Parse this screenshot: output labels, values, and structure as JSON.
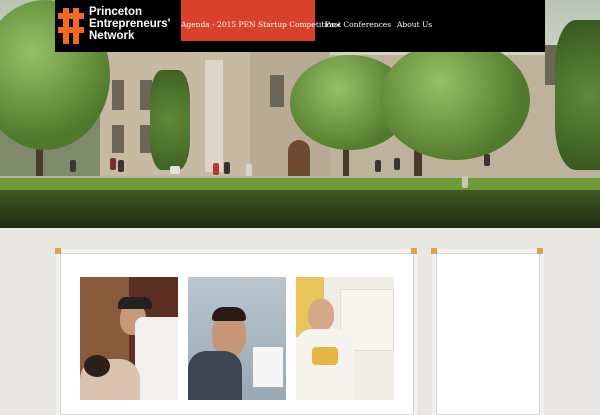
{
  "site": {
    "logo_line1": "Princeton",
    "logo_line2": "Entrepreneurs'",
    "logo_line3": "Network",
    "logo_icon": "pen-monogram-icon",
    "brand_color": "#f26a21"
  },
  "nav": {
    "items": [
      {
        "label": "Agenda - 2015 PEN Startup Competition",
        "active": true,
        "has_dropdown": true
      },
      {
        "label": "Past Conferences",
        "active": false
      },
      {
        "label": "About Us",
        "active": false
      }
    ],
    "caret": "▾",
    "active_color": "#d9412b"
  },
  "hero": {
    "subject": "campus-courtyard-photo"
  },
  "gallery": {
    "photos": [
      "speaker-photo",
      "attendee-photo",
      "presenter-photo"
    ]
  }
}
